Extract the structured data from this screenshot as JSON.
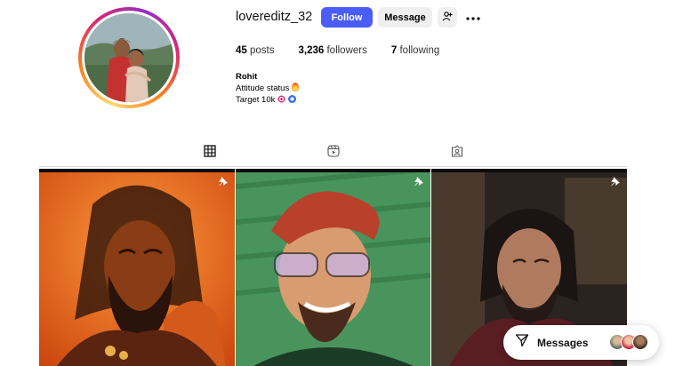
{
  "profile": {
    "username": "lovereditz_32",
    "follow_label": "Follow",
    "message_label": "Message",
    "stats": {
      "posts_count": "45",
      "posts_label": "posts",
      "followers_count": "3,236",
      "followers_label": "followers",
      "following_count": "7",
      "following_label": "following"
    },
    "bio": {
      "name": "Rohit",
      "line1": "Attitude status",
      "line2": "Target 10k"
    }
  },
  "tabs": [
    {
      "icon": "grid-icon",
      "active": true
    },
    {
      "icon": "reels-icon",
      "active": false
    },
    {
      "icon": "tagged-icon",
      "active": false
    }
  ],
  "posts": [
    {
      "pinned": true,
      "tone": "#e8631a"
    },
    {
      "pinned": true,
      "tone": "#3f8b52"
    },
    {
      "pinned": true,
      "tone": "#3a2a24"
    }
  ],
  "messages": {
    "label": "Messages"
  },
  "colors": {
    "follow_button": "#4a5df9",
    "secondary_button": "#efefef",
    "story_ring": "#d62976"
  }
}
